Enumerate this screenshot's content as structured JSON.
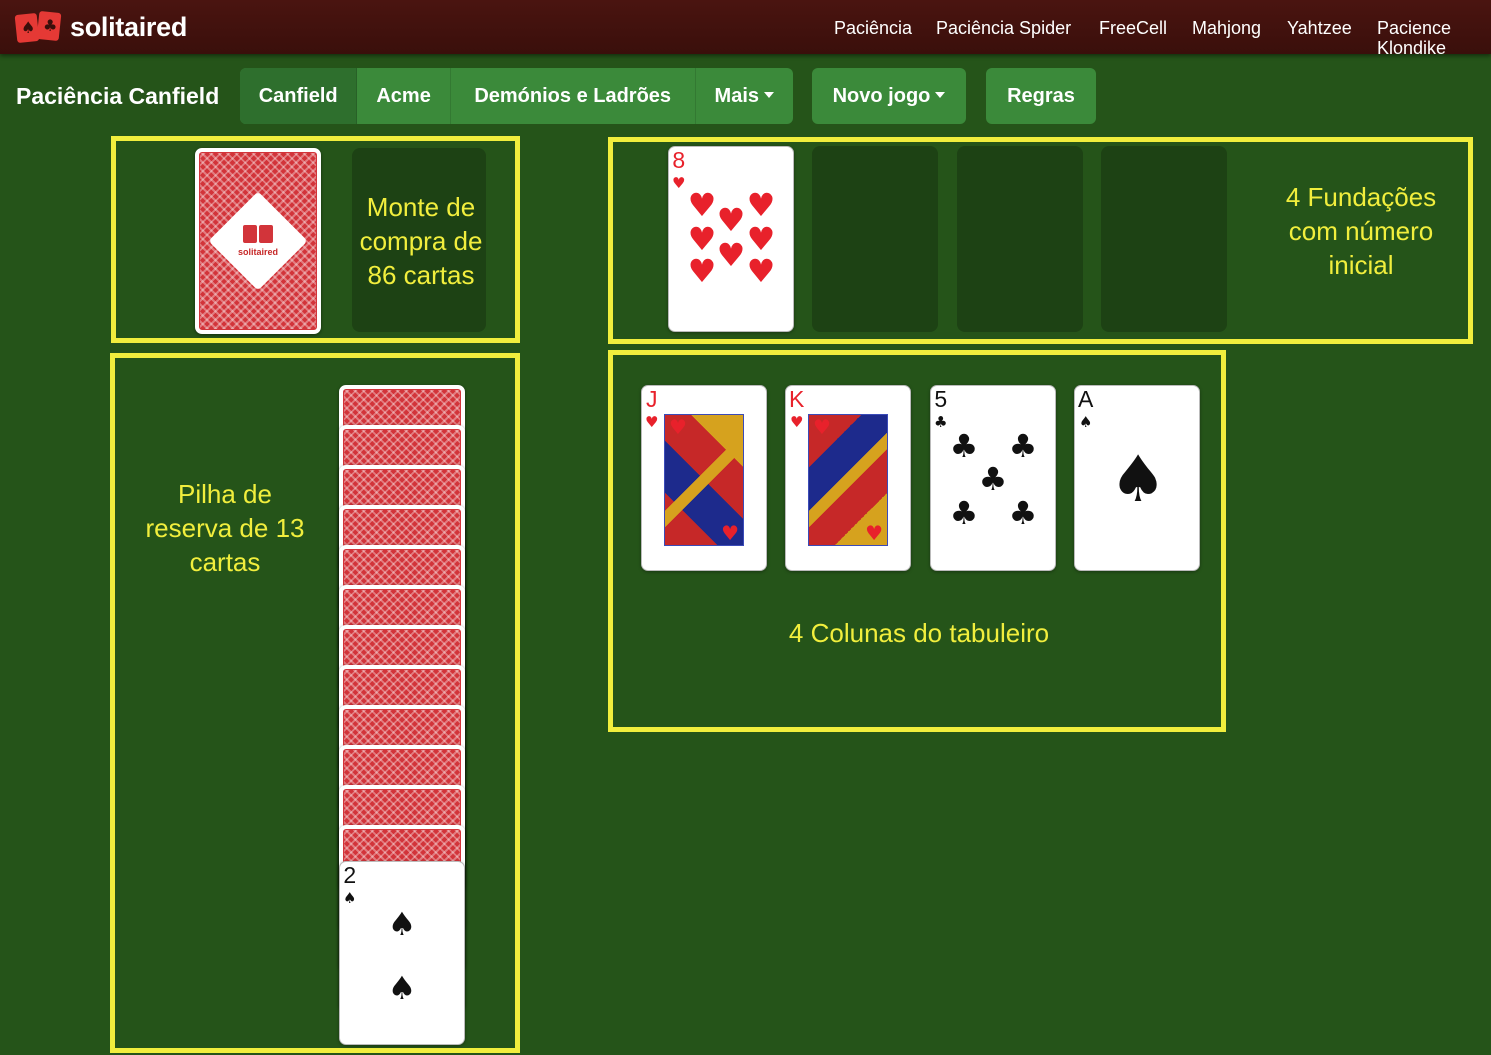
{
  "brand": {
    "name": "solitaired",
    "accent": "#e53935"
  },
  "nav": [
    "Paciência",
    "Paciência Spider",
    "FreeCell",
    "Mahjong",
    "Yahtzee",
    "Pacience Klondike"
  ],
  "page_title": "Paciência Canfield",
  "variant_tabs": [
    "Canfield",
    "Acme",
    "Demónios e Ladrões",
    "Mais"
  ],
  "active_tab": "Canfield",
  "buttons": {
    "new_game": "Novo jogo",
    "rules": "Regras"
  },
  "annotations": {
    "stock": "Monte de compra de 86 cartas",
    "foundations": "4 Fundações com número inicial",
    "reserve": "Pilha de reserva de 13 cartas",
    "tableau": "4 Colunas do tabuleiro"
  },
  "back_emblem_text": "solitaired",
  "foundation": [
    {
      "rank": "8",
      "suit": "♥",
      "color": "red"
    }
  ],
  "tableau": [
    {
      "rank": "J",
      "suit": "♥",
      "color": "red",
      "face": true
    },
    {
      "rank": "K",
      "suit": "♥",
      "color": "red",
      "face": true
    },
    {
      "rank": "5",
      "suit": "♣",
      "color": "black",
      "face": false
    },
    {
      "rank": "A",
      "suit": "♠",
      "color": "black",
      "face": false
    }
  ],
  "reserve": {
    "face_down_count": 12,
    "top": {
      "rank": "2",
      "suit": "♠",
      "color": "black"
    }
  },
  "colors": {
    "felt": "#255419",
    "highlight": "#f1ee3d",
    "button": "#3b8a3a",
    "header": "#3a0f0b"
  }
}
